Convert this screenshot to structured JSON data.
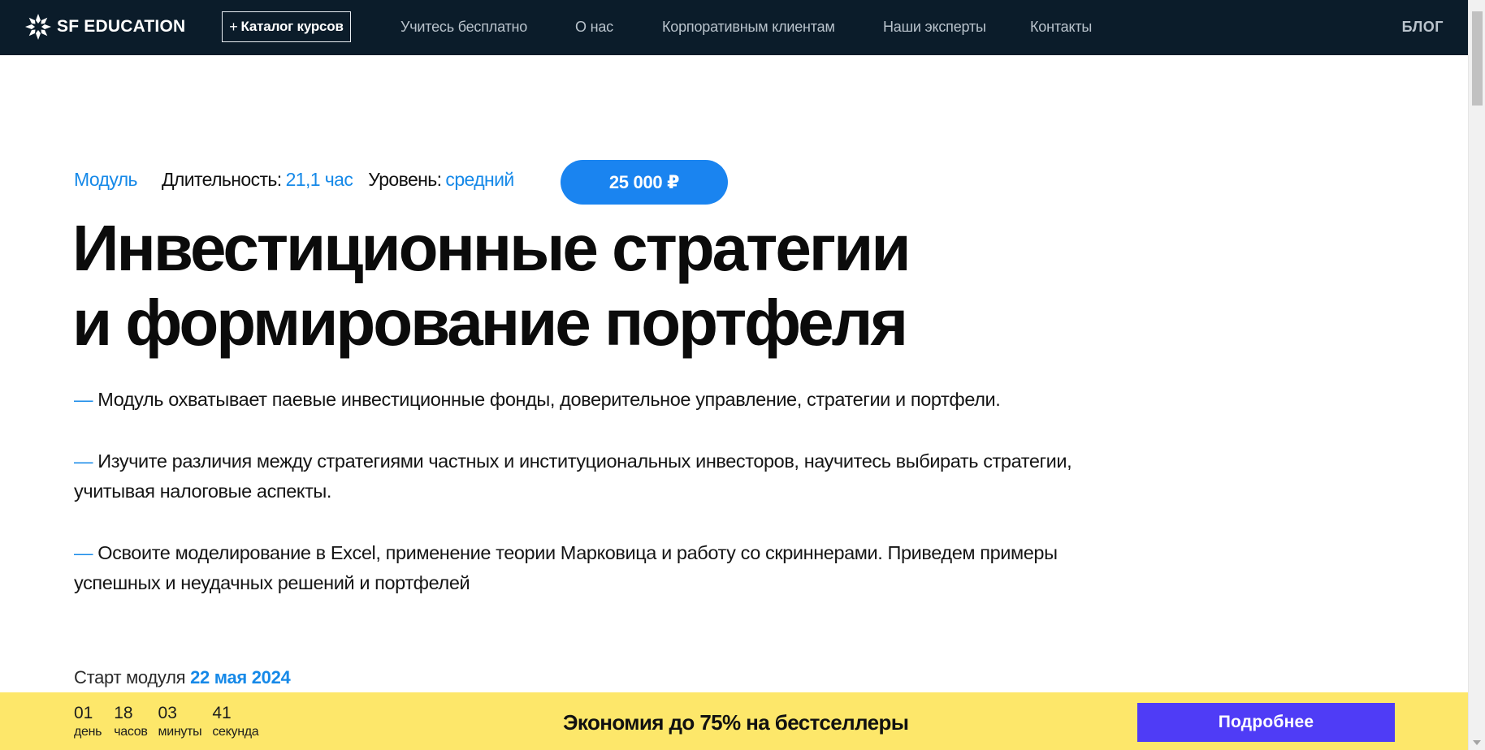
{
  "header": {
    "logo_text": "SF EDUCATION",
    "catalog_plus": "+",
    "catalog_label": "Каталог курсов",
    "nav": [
      {
        "label": "Учитесь бесплатно"
      },
      {
        "label": "О нас"
      },
      {
        "label": "Корпоративным клиентам"
      },
      {
        "label": "Наши эксперты"
      },
      {
        "label": "Контакты"
      }
    ],
    "blog_label": "БЛОГ"
  },
  "meta": {
    "type": "Модуль",
    "duration_label": "Длительность:",
    "duration_value": "21,1 час",
    "level_label": "Уровень:",
    "level_value": "средний",
    "price": "25 000 ₽"
  },
  "title": {
    "line1": "Инвестиционные стратегии",
    "line2": "и формирование портфеля"
  },
  "bullets": [
    {
      "dash": "—",
      "text": "Модуль охватывает паевые инвестиционные фонды, доверительное управление, стратегии и портфели."
    },
    {
      "dash": "—",
      "text": "Изучите различия между стратегиями частных и институциональных инвесторов, научитесь выбирать стратегии, учитывая налоговые аспекты."
    },
    {
      "dash": "—",
      "text": "Освоите моделирование в Excel, применение теории Марковица и работу со скриннерами. Приведем примеры успешных и неудачных решений и портфелей"
    }
  ],
  "start": {
    "label": "Старт модуля",
    "date": "22 мая 2024"
  },
  "promo": {
    "timer": [
      {
        "value": "01",
        "label": "день"
      },
      {
        "value": "18",
        "label": "часов"
      },
      {
        "value": "03",
        "label": "минуты"
      },
      {
        "value": "41",
        "label": "секунда"
      }
    ],
    "text": "Экономия до 75% на бестселлеры",
    "button_label": "Подробнее"
  },
  "colors": {
    "nav_bg": "#0b1c2a",
    "accent_blue": "#1689e8",
    "price_button": "#1a84f0",
    "promo_bg": "#fde76a",
    "promo_button": "#4f3cf6"
  }
}
